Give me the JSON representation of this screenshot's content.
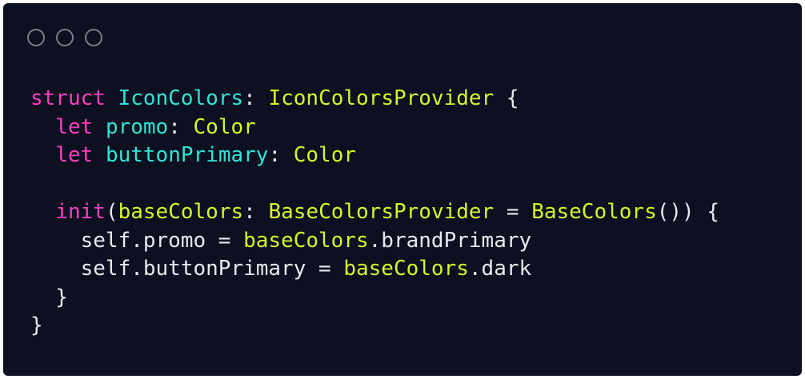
{
  "window": {
    "controls": [
      "close-dot",
      "minimize-dot",
      "zoom-dot"
    ]
  },
  "colors": {
    "background": "#0c1020",
    "keyword": "#ff3fbf",
    "identifier": "#2ee6d6",
    "type": "#d7f52b",
    "text": "#e8e8ee"
  },
  "code": {
    "l1": [
      "struct",
      " ",
      "IconColors",
      ": ",
      "IconColorsProvider",
      " {"
    ],
    "l2": [
      "  ",
      "let",
      " ",
      "promo",
      ": ",
      "Color"
    ],
    "l3": [
      "  ",
      "let",
      " ",
      "buttonPrimary",
      ": ",
      "Color"
    ],
    "l5": [
      "  ",
      "init",
      "(",
      "baseColors",
      ": ",
      "BaseColorsProvider",
      " = ",
      "BaseColors",
      "()) {"
    ],
    "l6": [
      "    self.promo = ",
      "baseColors",
      ".brandPrimary"
    ],
    "l7": [
      "    self.buttonPrimary = ",
      "baseColors",
      ".dark"
    ],
    "l8": [
      "  }"
    ],
    "l9": [
      "}"
    ]
  }
}
